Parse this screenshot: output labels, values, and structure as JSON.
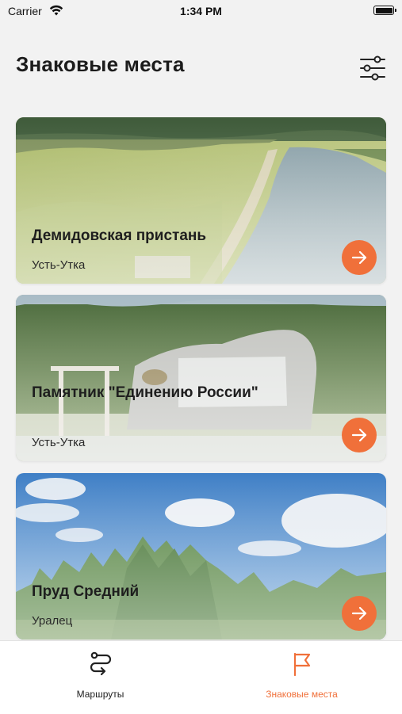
{
  "status_bar": {
    "carrier": "Carrier",
    "time": "1:34 PM",
    "wifi_icon": "wifi-icon",
    "battery_icon": "battery-full-icon"
  },
  "header": {
    "title": "Знаковые места",
    "filter_icon": "sliders-icon"
  },
  "colors": {
    "accent": "#f0703a",
    "background": "#f2f2f2",
    "tab_inactive": "#222222"
  },
  "places": [
    {
      "title": "Демидовская пристань",
      "subtitle": "Усть-Утка",
      "image": "river-meadow-photo",
      "button_icon": "arrow-right-icon"
    },
    {
      "title": "Памятник \"Единению России\"",
      "subtitle": "Усть-Утка",
      "image": "stone-monument-photo",
      "button_icon": "arrow-right-icon"
    },
    {
      "title": "Пруд Средний",
      "subtitle": "Уралец",
      "image": "sky-forest-photo",
      "button_icon": "arrow-right-icon"
    }
  ],
  "tab_bar": {
    "tabs": [
      {
        "label": "Маршруты",
        "icon": "route-icon",
        "active": false
      },
      {
        "label": "Знаковые места",
        "icon": "flag-icon",
        "active": true
      }
    ]
  }
}
